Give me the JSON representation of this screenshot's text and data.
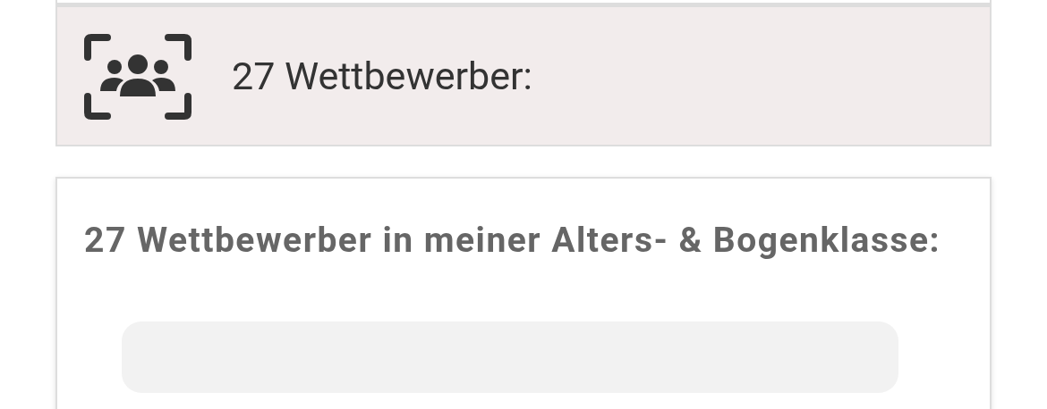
{
  "summary_banner": {
    "text": "27 Wettbewerber:"
  },
  "class_card": {
    "heading": "27 Wettbewerber in meiner Alters- & Bogenklasse:"
  }
}
